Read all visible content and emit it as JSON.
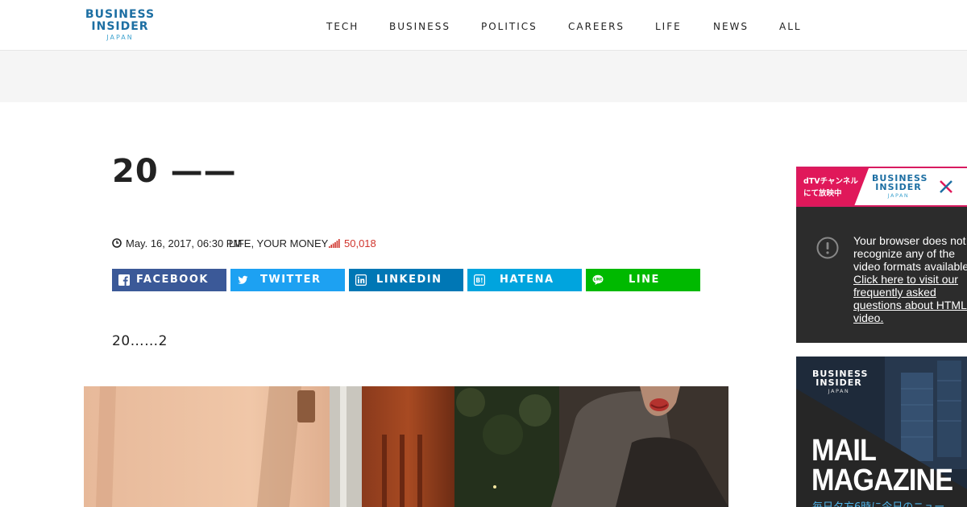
{
  "header": {
    "logo_line1": "BUSINESS",
    "logo_line2": "INSIDER",
    "logo_sub": "JAPAN",
    "nav": [
      "TECH",
      "BUSINESS",
      "POLITICS",
      "CAREERS",
      "LIFE",
      "NEWS",
      "ALL"
    ]
  },
  "article": {
    "title": "20 ——",
    "date": "May. 16, 2017, 06:30 PM",
    "categories": "LIFE, YOUR MONEY",
    "views": "50,018",
    "lead": "20……2",
    "share": [
      "FACEBOOK",
      "TWITTER",
      "LINKEDIN",
      "HATENA",
      "LINE"
    ]
  },
  "colors": {
    "facebook": "#3b5998",
    "twitter": "#1da1f2",
    "linkedin": "#0077b5",
    "hatena": "#00a4de",
    "line": "#00b900",
    "views": "#d0342c",
    "brand": "#1d6fa3"
  },
  "video_ad": {
    "badge_line1": "dTVチャンネル",
    "badge_line2": "にて放映中",
    "logo_line1": "BUSINESS",
    "logo_line2": "INSIDER",
    "logo_sub": "JAPAN",
    "message": "Your browser does not recognize any of the video formats available.",
    "link": "Click here to visit our frequently asked questions about HTML5 video."
  },
  "mail_ad": {
    "logo_line1": "BUSINESS",
    "logo_line2": "INSIDER",
    "logo_sub": "JAPAN",
    "title_line1": "MAIL",
    "title_line2": "MAGAZINE",
    "subtitle": "毎日夕方6時に今日のニュー"
  },
  "icons": [
    "clock-icon",
    "views-bars-icon",
    "facebook-icon",
    "twitter-icon",
    "linkedin-icon",
    "hatena-icon",
    "line-icon",
    "close-icon",
    "warning-icon"
  ]
}
